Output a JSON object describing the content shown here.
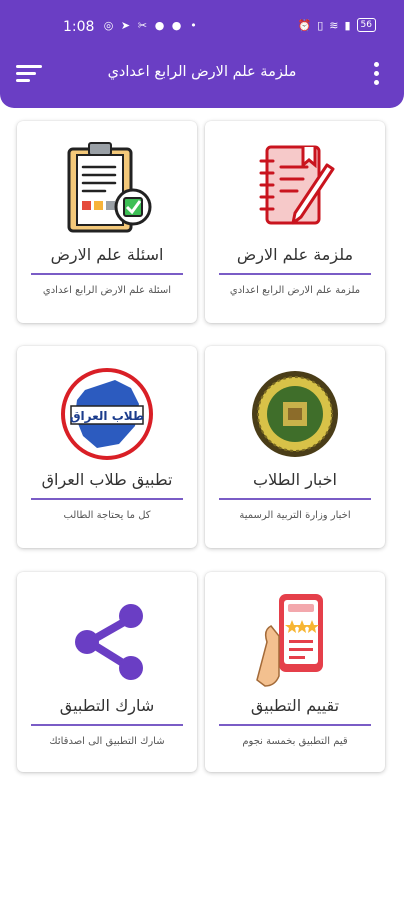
{
  "status_bar": {
    "time": "1:08",
    "notif_icons": [
      "whatsapp-icon",
      "telegram-icon",
      "tools-icon",
      "messenger-icon",
      "facebook-icon",
      "dot-icon"
    ],
    "battery": "56"
  },
  "app_bar": {
    "title": "ملزمة علم الارض الرابع اعدادي",
    "color": "#6a3ec4"
  },
  "cards": [
    {
      "title": "ملزمة علم الارض",
      "subtitle": "ملزمة علم الارض الرابع اعدادي",
      "icon": "notebook-pencil-icon"
    },
    {
      "title": "اسئلة علم الارض",
      "subtitle": "اسئلة علم الارض الرابع اعدادي",
      "icon": "checklist-clipboard-icon"
    },
    {
      "title": "اخبار الطلاب",
      "subtitle": "اخبار وزارة التربية الرسمية",
      "icon": "ministry-emblem-icon"
    },
    {
      "title": "تطبيق طلاب العراق",
      "subtitle": "كل ما يحتاجة الطالب",
      "icon": "iraq-map-icon",
      "emblem_text": "طلاب العراق"
    },
    {
      "title": "تقييم التطبيق",
      "subtitle": "قيم التطبيق بخمسة نجوم",
      "icon": "rate-phone-icon"
    },
    {
      "title": "شارك التطبيق",
      "subtitle": "شارك التطبيق الى اصدقائك",
      "icon": "share-icon"
    }
  ]
}
